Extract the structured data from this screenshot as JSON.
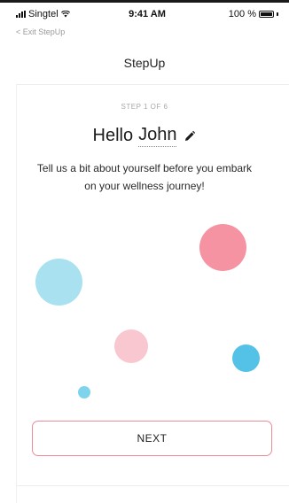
{
  "status_bar": {
    "carrier": "Singtel",
    "time": "9:41 AM",
    "battery": "100 %",
    "icons": [
      "signal-icon",
      "wifi-icon",
      "battery-icon"
    ]
  },
  "nav": {
    "exit_label": "< Exit StepUp",
    "title": "StepUp"
  },
  "content": {
    "step_label": "STEP 1 OF 6",
    "step_current": 1,
    "step_total": 6,
    "greeting": "Hello",
    "name": "John",
    "edit_icon": "pencil-icon",
    "intro": "Tell us a bit about yourself before you embark on your wellness journey!"
  },
  "decor": {
    "colors": [
      "#f593a2",
      "#a9e1f1",
      "#f8c7cf",
      "#53c2e6",
      "#7fd3ec"
    ]
  },
  "actions": {
    "next_label": "NEXT",
    "next_border_color": "#ec8c98"
  }
}
